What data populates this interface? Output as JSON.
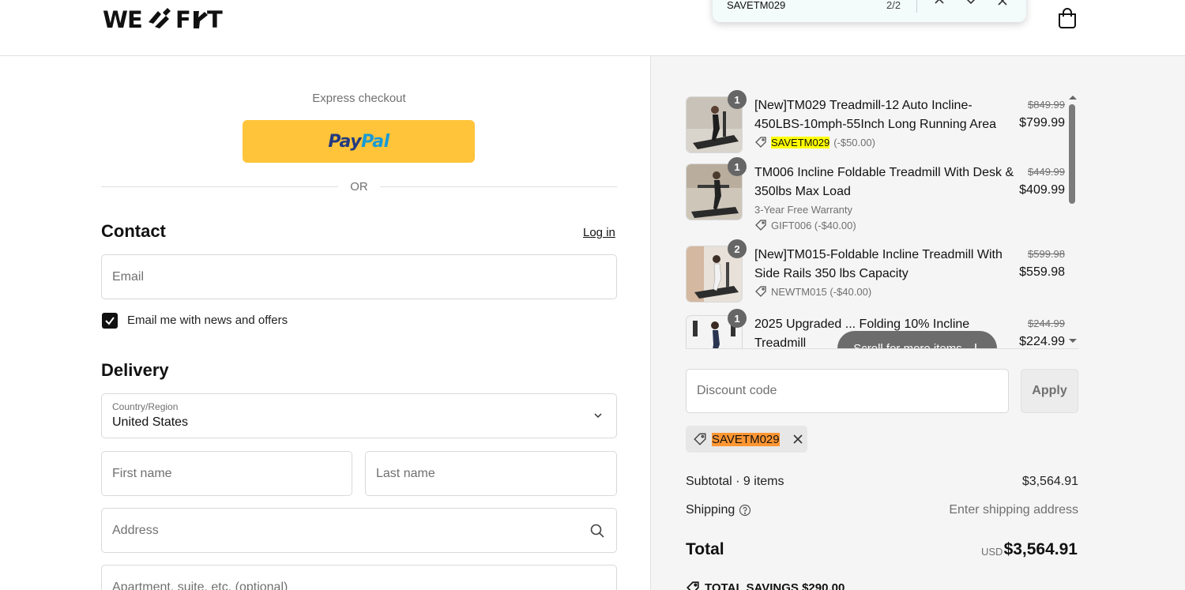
{
  "header": {
    "logo_text": "WE FIT",
    "cart_icon": "shopping-bag-icon"
  },
  "find_bar": {
    "query": "SAVETM029",
    "count": "2/2"
  },
  "express": {
    "label": "Express checkout",
    "paypal_pay": "Pay",
    "paypal_pal": "Pal",
    "or": "OR"
  },
  "contact": {
    "title": "Contact",
    "login": "Log in",
    "email_placeholder": "Email",
    "newsletter_label": "Email me with news and offers",
    "newsletter_checked": true
  },
  "delivery": {
    "title": "Delivery",
    "country_label": "Country/Region",
    "country_value": "United States",
    "first_name": "First name",
    "last_name": "Last name",
    "address": "Address",
    "apartment": "Apartment, suite, etc. (optional)"
  },
  "cart": {
    "items": [
      {
        "qty": "1",
        "title": "[New]TM029 Treadmill-12 Auto Incline-450LBS-10mph-55Inch Long Running Area",
        "code": "SAVETM029",
        "code_amount": "(-$50.00)",
        "price_old": "$849.99",
        "price_new": "$799.99"
      },
      {
        "qty": "1",
        "title": "TM006 Incline Foldable Treadmill With Desk & 350lbs Max Load",
        "subtitle": "3-Year Free Warranty",
        "code": "GIFT006 (-$40.00)",
        "price_old": "$449.99",
        "price_new": "$409.99"
      },
      {
        "qty": "2",
        "title": "[New]TM015-Foldable Incline Treadmill With Side Rails 350 lbs Capacity",
        "code": "NEWTM015 (-$40.00)",
        "price_old": "$599.98",
        "price_new": "$559.98"
      },
      {
        "qty": "1",
        "title": "2025 Upgraded ... Folding 10% Incline Treadmill",
        "price_old": "$244.99",
        "price_new": "$224.99"
      }
    ],
    "scroll_hint": "Scroll for more items",
    "discount_placeholder": "Discount code",
    "apply": "Apply",
    "applied_code": "SAVETM029",
    "subtotal_label": "Subtotal · 9 items",
    "subtotal_value": "$3,564.91",
    "shipping_label": "Shipping",
    "shipping_value": "Enter shipping address",
    "total_label": "Total",
    "total_currency": "USD",
    "total_value": "$3,564.91",
    "savings": "TOTAL SAVINGS  $290.00"
  },
  "colors": {
    "paypal_yellow": "#ffc439",
    "find_highlight": "#ffff00",
    "find_active": "#ff9632",
    "summary_bg": "#f5f5f5"
  }
}
